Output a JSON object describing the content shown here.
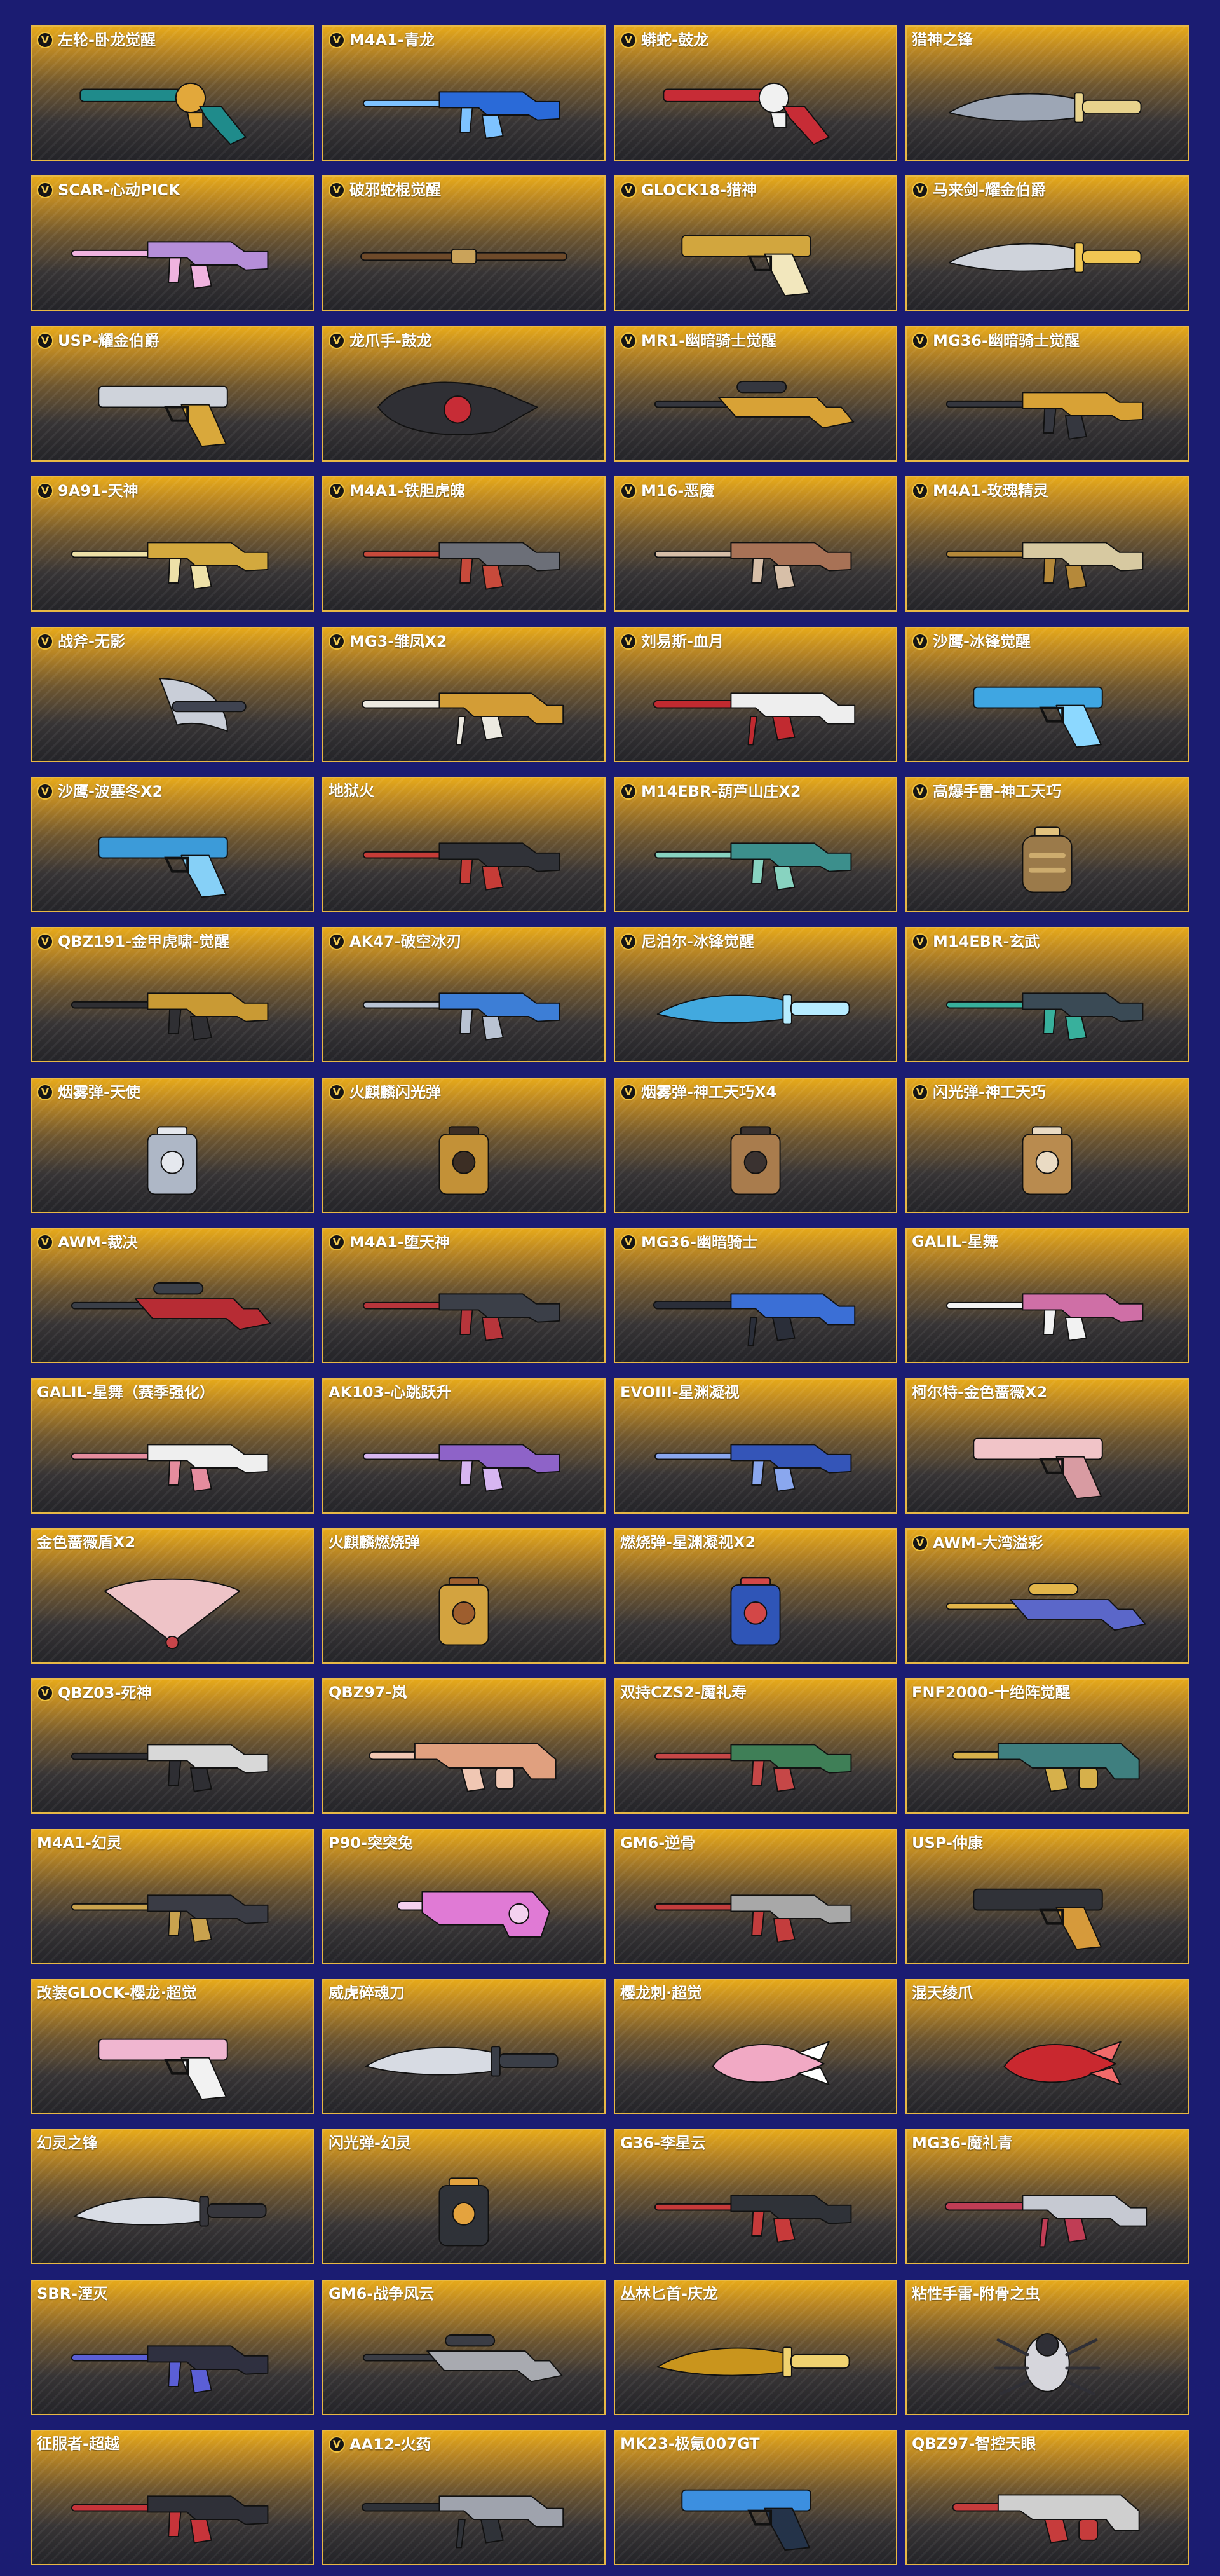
{
  "items": [
    {
      "name": "左轮-卧龙觉醒",
      "badge": "V",
      "icon": "revolver",
      "colors": [
        "#1f8b8b",
        "#e2a83b"
      ]
    },
    {
      "name": "M4A1-青龙",
      "badge": "V",
      "icon": "rifle",
      "colors": [
        "#2a6ad8",
        "#7ec3ff"
      ]
    },
    {
      "name": "蟒蛇-鼓龙",
      "badge": "V",
      "icon": "revolver",
      "colors": [
        "#c72c36",
        "#f1f1f1"
      ]
    },
    {
      "name": "猎神之锋",
      "icon": "knife",
      "colors": [
        "#9da6b5",
        "#e8d38d"
      ]
    },
    {
      "name": "SCAR-心动PICK",
      "badge": "V",
      "icon": "rifle",
      "colors": [
        "#b58ed8",
        "#f0b3df"
      ]
    },
    {
      "name": "破邪蛇棍觉醒",
      "badge": "V",
      "icon": "staff",
      "colors": [
        "#6e4a2a",
        "#caa35a"
      ]
    },
    {
      "name": "GLOCK18-猎神",
      "badge": "V",
      "icon": "pistol",
      "colors": [
        "#d2a63e",
        "#f2e7bd"
      ]
    },
    {
      "name": "马来剑-耀金伯爵",
      "badge": "V",
      "icon": "knife",
      "colors": [
        "#cfd3db",
        "#f0c653"
      ]
    },
    {
      "name": "USP-耀金伯爵",
      "badge": "V",
      "icon": "pistol",
      "colors": [
        "#cfd3db",
        "#d9a83b"
      ]
    },
    {
      "name": "龙爪手-鼓龙",
      "badge": "V",
      "icon": "gauntlet",
      "colors": [
        "#2f2f34",
        "#c72c36"
      ]
    },
    {
      "name": "MR1-幽暗骑士觉醒",
      "badge": "V",
      "icon": "sniper",
      "colors": [
        "#d8a236",
        "#35373f"
      ]
    },
    {
      "name": "MG36-幽暗骑士觉醒",
      "badge": "V",
      "icon": "rifle",
      "colors": [
        "#d8a236",
        "#35373f"
      ]
    },
    {
      "name": "9A91-天神",
      "badge": "V",
      "icon": "rifle",
      "colors": [
        "#d3a93e",
        "#eee1a8"
      ]
    },
    {
      "name": "M4A1-铁胆虎魄",
      "badge": "V",
      "icon": "rifle",
      "colors": [
        "#6c6f78",
        "#c74a3b"
      ]
    },
    {
      "name": "M16-恶魔",
      "badge": "V",
      "icon": "rifle",
      "colors": [
        "#a87256",
        "#d7bfa8"
      ]
    },
    {
      "name": "M4A1-玫瑰精灵",
      "badge": "V",
      "icon": "rifle",
      "colors": [
        "#d7c9a1",
        "#b5893a"
      ]
    },
    {
      "name": "战斧-无影",
      "badge": "V",
      "icon": "axe",
      "colors": [
        "#c9ced8",
        "#3f4350"
      ]
    },
    {
      "name": "MG3-雏凤X2",
      "badge": "V",
      "icon": "mg",
      "colors": [
        "#d39d36",
        "#ece9e0"
      ]
    },
    {
      "name": "刘易斯-血月",
      "badge": "V",
      "icon": "mg",
      "colors": [
        "#eeeeee",
        "#c12a30"
      ]
    },
    {
      "name": "沙鹰-冰锋觉醒",
      "badge": "V",
      "icon": "pistol",
      "colors": [
        "#3fa6e2",
        "#8cd8ff"
      ]
    },
    {
      "name": "沙鹰-波塞冬X2",
      "badge": "V",
      "icon": "pistol",
      "colors": [
        "#3c9bd9",
        "#86d0f7"
      ]
    },
    {
      "name": "地狱火",
      "icon": "rifle",
      "colors": [
        "#303238",
        "#c63c37"
      ]
    },
    {
      "name": "M14EBR-葫芦山庄X2",
      "badge": "V",
      "icon": "rifle",
      "colors": [
        "#3c8f8c",
        "#88d3c0"
      ]
    },
    {
      "name": "高爆手雷-神工天巧",
      "badge": "V",
      "icon": "grenade",
      "colors": [
        "#9b7a4a",
        "#e2c27e"
      ]
    },
    {
      "name": "QBZ191-金甲虎啸-觉醒",
      "badge": "V",
      "icon": "rifle",
      "colors": [
        "#c99a34",
        "#2f2f33"
      ]
    },
    {
      "name": "AK47-破空冰刃",
      "badge": "V",
      "icon": "rifle",
      "colors": [
        "#3d7ed6",
        "#b9c3d3"
      ]
    },
    {
      "name": "尼泊尔-冰锋觉醒",
      "badge": "V",
      "icon": "knife",
      "colors": [
        "#42a9df",
        "#b7ecff"
      ]
    },
    {
      "name": "M14EBR-玄武",
      "badge": "V",
      "icon": "rifle",
      "colors": [
        "#3a4a55",
        "#38b09c"
      ]
    },
    {
      "name": "烟雾弹-天使",
      "badge": "V",
      "icon": "canister",
      "colors": [
        "#aeb7c6",
        "#e5e8ee"
      ]
    },
    {
      "name": "火麒麟闪光弹",
      "badge": "V",
      "icon": "canister",
      "colors": [
        "#c39137",
        "#3c2e24"
      ]
    },
    {
      "name": "烟雾弹-神工天巧X4",
      "badge": "V",
      "icon": "canister",
      "colors": [
        "#a97c4d",
        "#3a3230"
      ]
    },
    {
      "name": "闪光弹-神工天巧",
      "badge": "V",
      "icon": "canister",
      "colors": [
        "#b98b4f",
        "#eadbc4"
      ]
    },
    {
      "name": "AWM-裁决",
      "badge": "V",
      "icon": "sniper",
      "colors": [
        "#b72c34",
        "#3a3f48"
      ]
    },
    {
      "name": "M4A1-堕天神",
      "badge": "V",
      "icon": "rifle",
      "colors": [
        "#3b3f48",
        "#b7353b"
      ]
    },
    {
      "name": "MG36-幽暗骑士",
      "badge": "V",
      "icon": "mg",
      "colors": [
        "#3b6fd6",
        "#2a2e39"
      ]
    },
    {
      "name": "GALIL-星舞",
      "icon": "rifle",
      "colors": [
        "#cf6fa6",
        "#f2f2f2"
      ]
    },
    {
      "name": "GALIL-星舞（赛季强化）",
      "icon": "rifle",
      "colors": [
        "#efefef",
        "#e58c9e"
      ]
    },
    {
      "name": "AK103-心跳跃升",
      "icon": "rifle",
      "colors": [
        "#8e63c8",
        "#d7b6f1"
      ]
    },
    {
      "name": "EVOIII-星渊凝视",
      "icon": "rifle",
      "colors": [
        "#3455b8",
        "#8aa7ee"
      ]
    },
    {
      "name": "柯尔特-金色蔷薇X2",
      "icon": "pistol",
      "colors": [
        "#f1c4c8",
        "#d89ba2"
      ]
    },
    {
      "name": "金色蔷薇盾X2",
      "icon": "fan",
      "colors": [
        "#eec3c7",
        "#c7454a"
      ]
    },
    {
      "name": "火麒麟燃烧弹",
      "icon": "canister",
      "colors": [
        "#d3a33f",
        "#9e5e2e"
      ]
    },
    {
      "name": "燃烧弹-星渊凝视X2",
      "icon": "canister",
      "colors": [
        "#2f55b7",
        "#d34747"
      ]
    },
    {
      "name": "AWM-大湾溢彩",
      "badge": "V",
      "icon": "sniper",
      "colors": [
        "#5b67c9",
        "#e2b54a"
      ]
    },
    {
      "name": "QBZ03-死神",
      "badge": "V",
      "icon": "rifle",
      "colors": [
        "#d8d8d8",
        "#2e2e33"
      ]
    },
    {
      "name": "QBZ97-岚",
      "icon": "bullpup",
      "colors": [
        "#e0a07f",
        "#f0c7b3"
      ]
    },
    {
      "name": "双持CZS2-魔礼寿",
      "icon": "rifle",
      "colors": [
        "#3f7f57",
        "#c64747"
      ]
    },
    {
      "name": "FNF2000-十绝阵觉醒",
      "icon": "bullpup",
      "colors": [
        "#3f7f7f",
        "#d6b04b"
      ]
    },
    {
      "name": "M4A1-幻灵",
      "icon": "rifle",
      "colors": [
        "#3a3c45",
        "#c9a24e"
      ]
    },
    {
      "name": "P90-突突兔",
      "icon": "smg",
      "colors": [
        "#e07ad5",
        "#f4d1ef"
      ]
    },
    {
      "name": "GM6-逆骨",
      "icon": "rifle",
      "colors": [
        "#a8a8a8",
        "#c33d3d"
      ]
    },
    {
      "name": "USP-仲康",
      "icon": "pistol",
      "colors": [
        "#303238",
        "#d69a3b"
      ]
    },
    {
      "name": "改装GLOCK-樱龙·超觉",
      "icon": "pistol",
      "colors": [
        "#f0b6d0",
        "#f2f2f2"
      ]
    },
    {
      "name": "威虎碎魂刀",
      "icon": "knife",
      "colors": [
        "#d7dbe3",
        "#3a3e47"
      ]
    },
    {
      "name": "樱龙刺·超觉",
      "icon": "claw",
      "colors": [
        "#f1a9c4",
        "#ffffff"
      ]
    },
    {
      "name": "混天绫爪",
      "icon": "claw",
      "colors": [
        "#c9282f",
        "#f16a6a"
      ]
    },
    {
      "name": "幻灵之锋",
      "icon": "knife",
      "colors": [
        "#d9dde5",
        "#36363c"
      ]
    },
    {
      "name": "闪光弹-幻灵",
      "icon": "canister",
      "colors": [
        "#2f3238",
        "#e4a33e"
      ]
    },
    {
      "name": "G36-李星云",
      "icon": "rifle",
      "colors": [
        "#2f3238",
        "#c73a3a"
      ]
    },
    {
      "name": "MG36-魔礼青",
      "icon": "mg",
      "colors": [
        "#c6c9d2",
        "#c03d55"
      ]
    },
    {
      "name": "SBR-湮灭",
      "icon": "rifle",
      "colors": [
        "#2f3040",
        "#5b5fd6"
      ]
    },
    {
      "name": "GM6-战争风云",
      "icon": "sniper",
      "colors": [
        "#a8aab0",
        "#3b3d45"
      ]
    },
    {
      "name": "丛林匕首-庆龙",
      "icon": "knife",
      "colors": [
        "#c9951d",
        "#f0d270"
      ]
    },
    {
      "name": "粘性手雷-附骨之虫",
      "icon": "bug",
      "colors": [
        "#d6d6dc",
        "#2f2f36"
      ]
    },
    {
      "name": "征服者-超越",
      "icon": "rifle",
      "colors": [
        "#2f3038",
        "#c7343a"
      ]
    },
    {
      "name": "AA12-火药",
      "badge": "V",
      "icon": "mg",
      "colors": [
        "#9fa3ad",
        "#2f3238"
      ]
    },
    {
      "name": "MK23-极氪007GT",
      "icon": "pistol",
      "colors": [
        "#3c8fe0",
        "#243349"
      ]
    },
    {
      "name": "QBZ97-智控天眼",
      "icon": "bullpup",
      "colors": [
        "#cfcfcf",
        "#c63c3c"
      ]
    }
  ]
}
